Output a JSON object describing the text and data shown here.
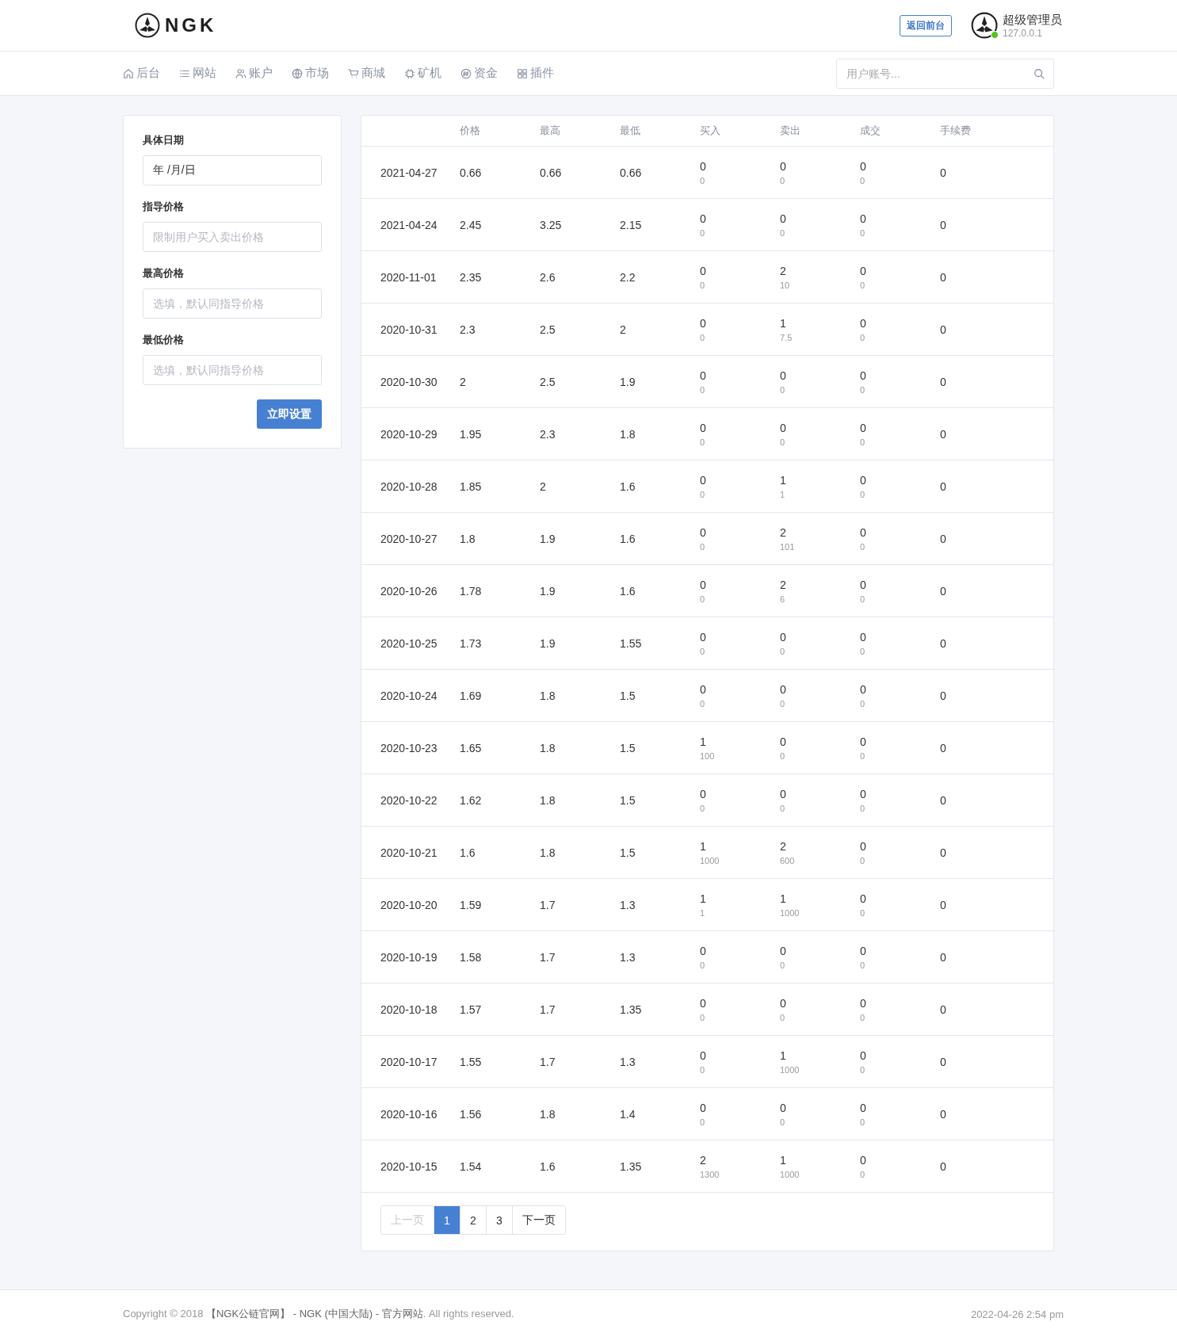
{
  "header": {
    "logo": "NGK",
    "back_button": "返回前台",
    "user": {
      "name": "超级管理员",
      "ip": "127.0.0.1",
      "online": true
    }
  },
  "nav": {
    "items": [
      {
        "label": "后台",
        "kind": "home"
      },
      {
        "label": "网站",
        "kind": "list"
      },
      {
        "label": "账户",
        "kind": "users"
      },
      {
        "label": "市场",
        "kind": "globe"
      },
      {
        "label": "商城",
        "kind": "cart"
      },
      {
        "label": "矿机",
        "kind": "chip"
      },
      {
        "label": "资金",
        "kind": "coin"
      },
      {
        "label": "插件",
        "kind": "grid"
      }
    ],
    "search": {
      "placeholder": "用户账号..."
    }
  },
  "form": {
    "fields": [
      {
        "label": "具体日期",
        "value": "年 /月/日"
      },
      {
        "label": "指导价格",
        "placeholder": "限制用户买入卖出价格"
      },
      {
        "label": "最高价格",
        "placeholder": "选填，默认同指导价格"
      },
      {
        "label": "最低价格",
        "placeholder": "选填，默认同指导价格"
      }
    ],
    "submit": "立即设置"
  },
  "table": {
    "columns": [
      "价格",
      "最高",
      "最低",
      "买入",
      "卖出",
      "成交",
      "手续费"
    ],
    "rows": [
      {
        "date": "2021-04-27",
        "price": "0.66",
        "high": "0.66",
        "low": "0.66",
        "buy": [
          "0",
          "0"
        ],
        "sell": [
          "0",
          "0"
        ],
        "deal": [
          "0",
          "0"
        ],
        "fee": "0"
      },
      {
        "date": "2021-04-24",
        "price": "2.45",
        "high": "3.25",
        "low": "2.15",
        "buy": [
          "0",
          "0"
        ],
        "sell": [
          "0",
          "0"
        ],
        "deal": [
          "0",
          "0"
        ],
        "fee": "0"
      },
      {
        "date": "2020-11-01",
        "price": "2.35",
        "high": "2.6",
        "low": "2.2",
        "buy": [
          "0",
          "0"
        ],
        "sell": [
          "2",
          "10"
        ],
        "deal": [
          "0",
          "0"
        ],
        "fee": "0"
      },
      {
        "date": "2020-10-31",
        "price": "2.3",
        "high": "2.5",
        "low": "2",
        "buy": [
          "0",
          "0"
        ],
        "sell": [
          "1",
          "7.5"
        ],
        "deal": [
          "0",
          "0"
        ],
        "fee": "0"
      },
      {
        "date": "2020-10-30",
        "price": "2",
        "high": "2.5",
        "low": "1.9",
        "buy": [
          "0",
          "0"
        ],
        "sell": [
          "0",
          "0"
        ],
        "deal": [
          "0",
          "0"
        ],
        "fee": "0"
      },
      {
        "date": "2020-10-29",
        "price": "1.95",
        "high": "2.3",
        "low": "1.8",
        "buy": [
          "0",
          "0"
        ],
        "sell": [
          "0",
          "0"
        ],
        "deal": [
          "0",
          "0"
        ],
        "fee": "0"
      },
      {
        "date": "2020-10-28",
        "price": "1.85",
        "high": "2",
        "low": "1.6",
        "buy": [
          "0",
          "0"
        ],
        "sell": [
          "1",
          "1"
        ],
        "deal": [
          "0",
          "0"
        ],
        "fee": "0"
      },
      {
        "date": "2020-10-27",
        "price": "1.8",
        "high": "1.9",
        "low": "1.6",
        "buy": [
          "0",
          "0"
        ],
        "sell": [
          "2",
          "101"
        ],
        "deal": [
          "0",
          "0"
        ],
        "fee": "0"
      },
      {
        "date": "2020-10-26",
        "price": "1.78",
        "high": "1.9",
        "low": "1.6",
        "buy": [
          "0",
          "0"
        ],
        "sell": [
          "2",
          "6"
        ],
        "deal": [
          "0",
          "0"
        ],
        "fee": "0"
      },
      {
        "date": "2020-10-25",
        "price": "1.73",
        "high": "1.9",
        "low": "1.55",
        "buy": [
          "0",
          "0"
        ],
        "sell": [
          "0",
          "0"
        ],
        "deal": [
          "0",
          "0"
        ],
        "fee": "0"
      },
      {
        "date": "2020-10-24",
        "price": "1.69",
        "high": "1.8",
        "low": "1.5",
        "buy": [
          "0",
          "0"
        ],
        "sell": [
          "0",
          "0"
        ],
        "deal": [
          "0",
          "0"
        ],
        "fee": "0"
      },
      {
        "date": "2020-10-23",
        "price": "1.65",
        "high": "1.8",
        "low": "1.5",
        "buy": [
          "1",
          "100"
        ],
        "sell": [
          "0",
          "0"
        ],
        "deal": [
          "0",
          "0"
        ],
        "fee": "0"
      },
      {
        "date": "2020-10-22",
        "price": "1.62",
        "high": "1.8",
        "low": "1.5",
        "buy": [
          "0",
          "0"
        ],
        "sell": [
          "0",
          "0"
        ],
        "deal": [
          "0",
          "0"
        ],
        "fee": "0"
      },
      {
        "date": "2020-10-21",
        "price": "1.6",
        "high": "1.8",
        "low": "1.5",
        "buy": [
          "1",
          "1000"
        ],
        "sell": [
          "2",
          "600"
        ],
        "deal": [
          "0",
          "0"
        ],
        "fee": "0"
      },
      {
        "date": "2020-10-20",
        "price": "1.59",
        "high": "1.7",
        "low": "1.3",
        "buy": [
          "1",
          "1"
        ],
        "sell": [
          "1",
          "1000"
        ],
        "deal": [
          "0",
          "0"
        ],
        "fee": "0"
      },
      {
        "date": "2020-10-19",
        "price": "1.58",
        "high": "1.7",
        "low": "1.3",
        "buy": [
          "0",
          "0"
        ],
        "sell": [
          "0",
          "0"
        ],
        "deal": [
          "0",
          "0"
        ],
        "fee": "0"
      },
      {
        "date": "2020-10-18",
        "price": "1.57",
        "high": "1.7",
        "low": "1.35",
        "buy": [
          "0",
          "0"
        ],
        "sell": [
          "0",
          "0"
        ],
        "deal": [
          "0",
          "0"
        ],
        "fee": "0"
      },
      {
        "date": "2020-10-17",
        "price": "1.55",
        "high": "1.7",
        "low": "1.3",
        "buy": [
          "0",
          "0"
        ],
        "sell": [
          "1",
          "1000"
        ],
        "deal": [
          "0",
          "0"
        ],
        "fee": "0"
      },
      {
        "date": "2020-10-16",
        "price": "1.56",
        "high": "1.8",
        "low": "1.4",
        "buy": [
          "0",
          "0"
        ],
        "sell": [
          "0",
          "0"
        ],
        "deal": [
          "0",
          "0"
        ],
        "fee": "0"
      },
      {
        "date": "2020-10-15",
        "price": "1.54",
        "high": "1.6",
        "low": "1.35",
        "buy": [
          "2",
          "1300"
        ],
        "sell": [
          "1",
          "1000"
        ],
        "deal": [
          "0",
          "0"
        ],
        "fee": "0"
      }
    ]
  },
  "pagination": {
    "prev": {
      "label": "上一页",
      "disabled": true
    },
    "pages": [
      {
        "label": "1",
        "selected": true
      },
      {
        "label": "2",
        "selected": false
      },
      {
        "label": "3",
        "selected": false
      }
    ],
    "next": {
      "label": "下一页",
      "disabled": false
    }
  },
  "footer": {
    "before": "Copyright © 2018 ",
    "link": "【NGK公链官网】 - NGK (中国大陆) - 官方网站",
    "after": ". All rights reserved.",
    "time": "2022-04-26 2:54 pm"
  }
}
